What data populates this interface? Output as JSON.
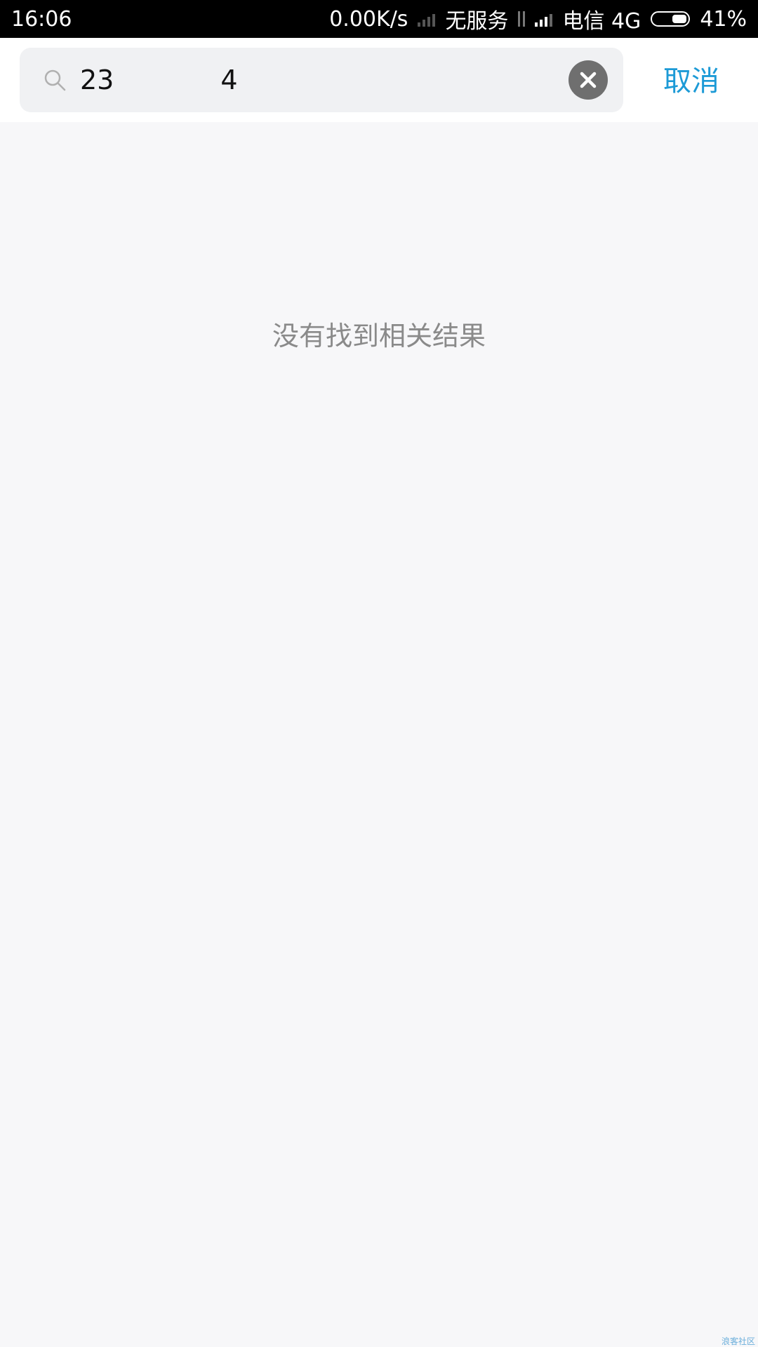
{
  "status_bar": {
    "time": "16:06",
    "net_speed": "0.00K/s",
    "no_service": "无服务",
    "carrier": "电信 4G",
    "battery": "41%"
  },
  "search": {
    "query": "23    4",
    "cancel_label": "取消"
  },
  "results": {
    "empty_message": "没有找到相关结果"
  },
  "watermark": "浪客社区",
  "colors": {
    "accent": "#1c9ad6",
    "background": "#f7f7f9",
    "status_bar": "#000000"
  }
}
